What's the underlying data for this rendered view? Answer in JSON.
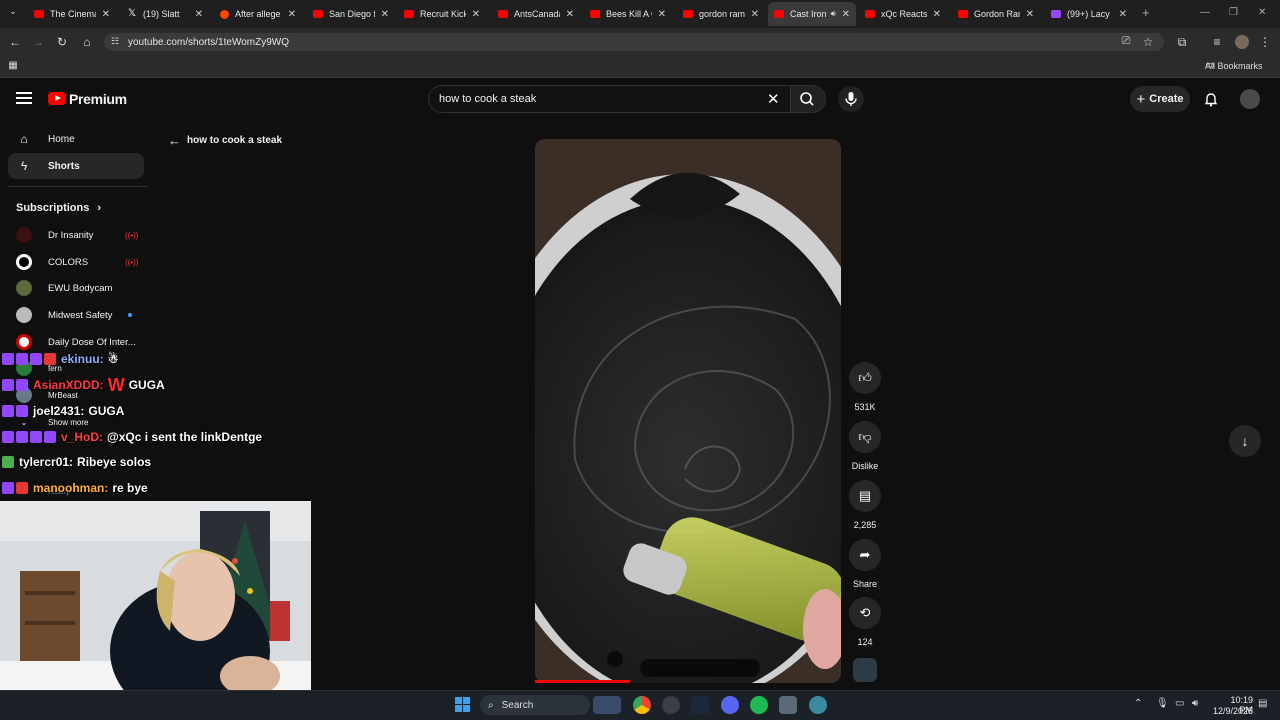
{
  "browser": {
    "tabs": [
      {
        "title": "The Cinemat",
        "favicon": "youtube-icon",
        "active": false
      },
      {
        "title": "(19) Slatt",
        "favicon": "x-icon",
        "active": false
      },
      {
        "title": "After allege",
        "favicon": "reddit-icon",
        "active": false
      },
      {
        "title": "San Diego fa",
        "favicon": "youtube-icon",
        "active": false
      },
      {
        "title": "Recruit Kick",
        "favicon": "youtube-icon",
        "active": false
      },
      {
        "title": "AntsCanada",
        "favicon": "youtube-icon",
        "active": false
      },
      {
        "title": "Bees Kill A G",
        "favicon": "youtube-icon",
        "active": false
      },
      {
        "title": "gordon ram",
        "favicon": "youtube-icon",
        "active": false
      },
      {
        "title": "Cast Iron",
        "favicon": "youtube-icon",
        "active": true
      },
      {
        "title": "xQc Reacts t",
        "favicon": "youtube-icon",
        "active": false
      },
      {
        "title": "Gordon Ram",
        "favicon": "youtube-icon",
        "active": false
      },
      {
        "title": "(99+) Lacy",
        "favicon": "twitch-icon",
        "active": false
      }
    ],
    "url": "youtube.com/shorts/1teWomZy9WQ",
    "bookmarks_label": "All Bookmarks"
  },
  "youtube": {
    "brand": "Premium",
    "search_value": "how to cook a steak",
    "create_label": "Create",
    "back_label": "how to cook a steak",
    "sidebar": {
      "items": [
        {
          "label": "Home",
          "icon": "home-icon"
        },
        {
          "label": "Shorts",
          "icon": "shorts-icon"
        }
      ],
      "subscriptions_title": "Subscriptions",
      "subscriptions": [
        {
          "label": "Dr Insanity",
          "live": true
        },
        {
          "label": "COLORS",
          "live": true
        },
        {
          "label": "EWU Bodycam",
          "live": false
        },
        {
          "label": "Midwest Safety",
          "new": true
        },
        {
          "label": "Daily Dose Of Inter...",
          "live": false
        },
        {
          "label": "fern",
          "live": false
        },
        {
          "label": "MrBeast",
          "live": false
        }
      ],
      "show_more": "Show more",
      "history": "History"
    },
    "actions": {
      "likes": "531K",
      "dislike": "Dislike",
      "comments": "2,285",
      "share": "Share",
      "remix": "124"
    },
    "video_progress": 0.31
  },
  "chat": [
    {
      "user": "ekinuu:",
      "message": "",
      "color": "#8ab4ff"
    },
    {
      "user": "AsianXDDD:",
      "message": "GUGA",
      "color": "#ff3b3b",
      "emote": "W"
    },
    {
      "user": "joel2431:",
      "message": "GUGA",
      "color": "#ffffff"
    },
    {
      "user": "v_HoD:",
      "message": "@xQc i sent the linkDentge",
      "color": "#ff4040"
    },
    {
      "user": "tylercr01:",
      "message": "Ribeye solos",
      "color": "#ffffff"
    },
    {
      "user": "manoohman:",
      "message": "re bye",
      "color": "#ffb13b"
    }
  ],
  "taskbar": {
    "search_label": "Search",
    "time": "10:19 PM",
    "date": "12/9/2025"
  }
}
